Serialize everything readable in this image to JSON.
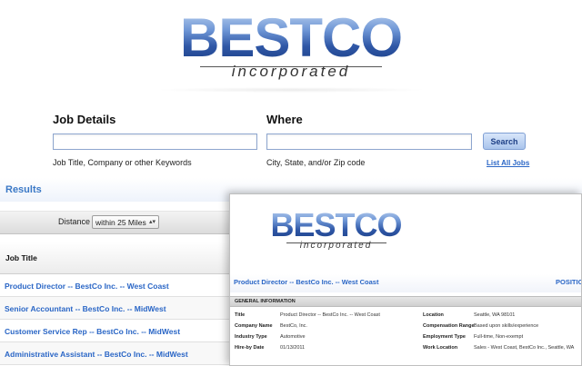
{
  "brand": {
    "logo_main": "BESTCO",
    "logo_sub": "incorporated"
  },
  "search": {
    "job_details_heading": "Job Details",
    "job_details_value": "",
    "job_details_hint": "Job Title, Company or other Keywords",
    "where_heading": "Where",
    "where_value": "",
    "where_hint": "City, State, and/or Zip code",
    "search_button": "Search",
    "list_all_link": "List All Jobs"
  },
  "results": {
    "title": "Results",
    "distance_label": "Distance :",
    "distance_selected": "within 25 Miles",
    "job_title_header": "Job Title",
    "jobs": [
      "Product Director -- BestCo Inc. -- West Coast",
      "Senior Accountant -- BestCo Inc. -- MidWest",
      "Customer Service Rep -- BestCo Inc. -- MidWest",
      "Administrative Assistant -- BestCo Inc. -- MidWest"
    ]
  },
  "detail": {
    "title": "Product Director -- BestCo Inc. -- West Coast",
    "position_label": "POSITIO",
    "section_header": "GENERAL INFORMATION",
    "left_fields": [
      {
        "label": "Title",
        "value": "Product Director -- BestCo Inc. -- West Coast"
      },
      {
        "label": "Company Name",
        "value": "BestCo, Inc."
      },
      {
        "label": "Industry Type",
        "value": "Automotive"
      },
      {
        "label": "Hire-by Date",
        "value": "01/13/2011"
      }
    ],
    "right_fields": [
      {
        "label": "Location",
        "value": "Seattle, WA 98101"
      },
      {
        "label": "Compensation Range",
        "value": "Based upon skills/experience"
      },
      {
        "label": "Employment Type",
        "value": "Full-time, Non-exempt"
      },
      {
        "label": "Work Location",
        "value": "Sales - West Coast, BestCo Inc., Seattle, WA"
      }
    ]
  },
  "colors": {
    "link_blue": "#2a66c6",
    "logo_blue": "#3f69b8",
    "results_blue": "#3a78c6"
  },
  "icons": {
    "select_chevron": "chevron-up-down-icon"
  }
}
